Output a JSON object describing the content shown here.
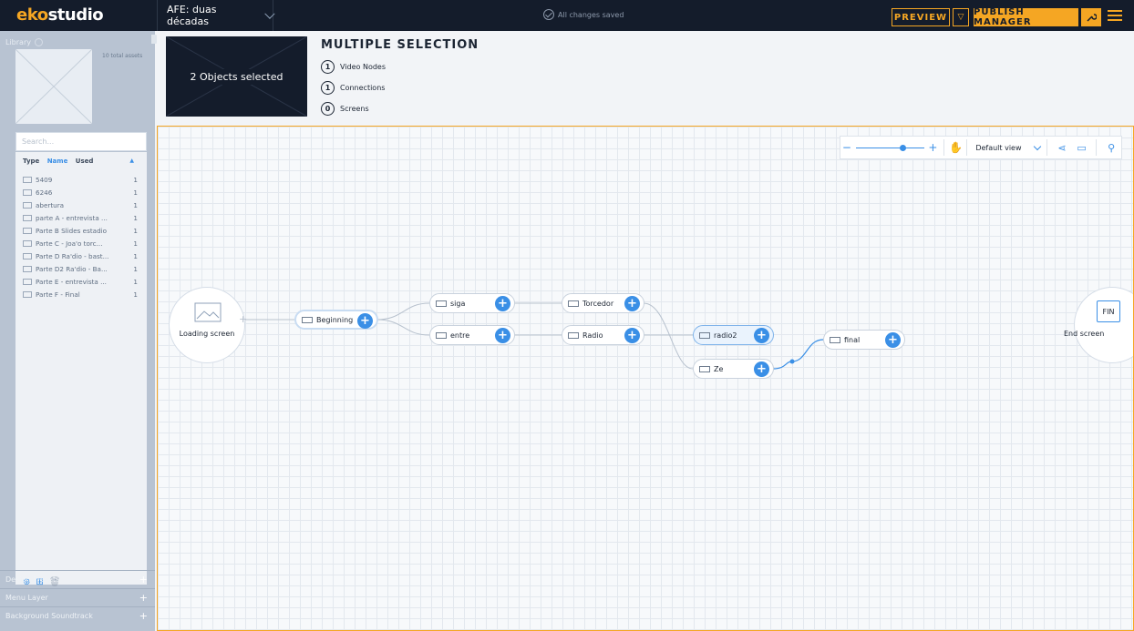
{
  "app": {
    "logo_eko": "eko",
    "logo_studio": "studio",
    "project": "AFE: duas décadas",
    "saved_status": "All changes saved",
    "preview": "PREVIEW",
    "dropdown_glyph": "▽",
    "publish": "PUBLISH MANAGER",
    "accent": "#f5a623"
  },
  "sidebar": {
    "library_title": "Library",
    "total_assets": "10 total assets",
    "search_placeholder": "Search...",
    "columns": {
      "type": "Type",
      "name": "Name",
      "used": "Used"
    },
    "assets": [
      {
        "name": "5409",
        "used": "1"
      },
      {
        "name": "6246",
        "used": "1"
      },
      {
        "name": "abertura",
        "used": "1"
      },
      {
        "name": "parte A - entrevista ...",
        "used": "1"
      },
      {
        "name": "Parte B Slides estadio",
        "used": "1"
      },
      {
        "name": "Parte C - Joa'o torc...",
        "used": "1"
      },
      {
        "name": "Parte D Ra'dio - bast...",
        "used": "1"
      },
      {
        "name": "Parte D2 Ra'dio - Ba...",
        "used": "1"
      },
      {
        "name": "Parte E - entrevista ...",
        "used": "1"
      },
      {
        "name": "Parte F - Final",
        "used": "1"
      }
    ],
    "sections": [
      "Design Presets",
      "Menu Layer",
      "Background Soundtrack"
    ]
  },
  "selection": {
    "thumb_text": "2 Objects selected",
    "title": "MULTIPLE SELECTION",
    "rows": [
      {
        "count": "1",
        "label": "Video Nodes"
      },
      {
        "count": "1",
        "label": "Connections"
      },
      {
        "count": "0",
        "label": "Screens"
      }
    ]
  },
  "toolbar": {
    "zoom_out": "−",
    "zoom_in": "+",
    "zoom_level": 0.65,
    "view": "Default view"
  },
  "graph": {
    "loading_screen": "Loading screen",
    "end_screen": "End screen",
    "end_badge": "FIN",
    "nodes": {
      "beginning": "Beginning",
      "siga": "siga",
      "entre": "entre",
      "torcedor": "Torcedor",
      "radio": "Radio",
      "radio2": "radio2",
      "ze": "Ze",
      "final": "final"
    }
  }
}
